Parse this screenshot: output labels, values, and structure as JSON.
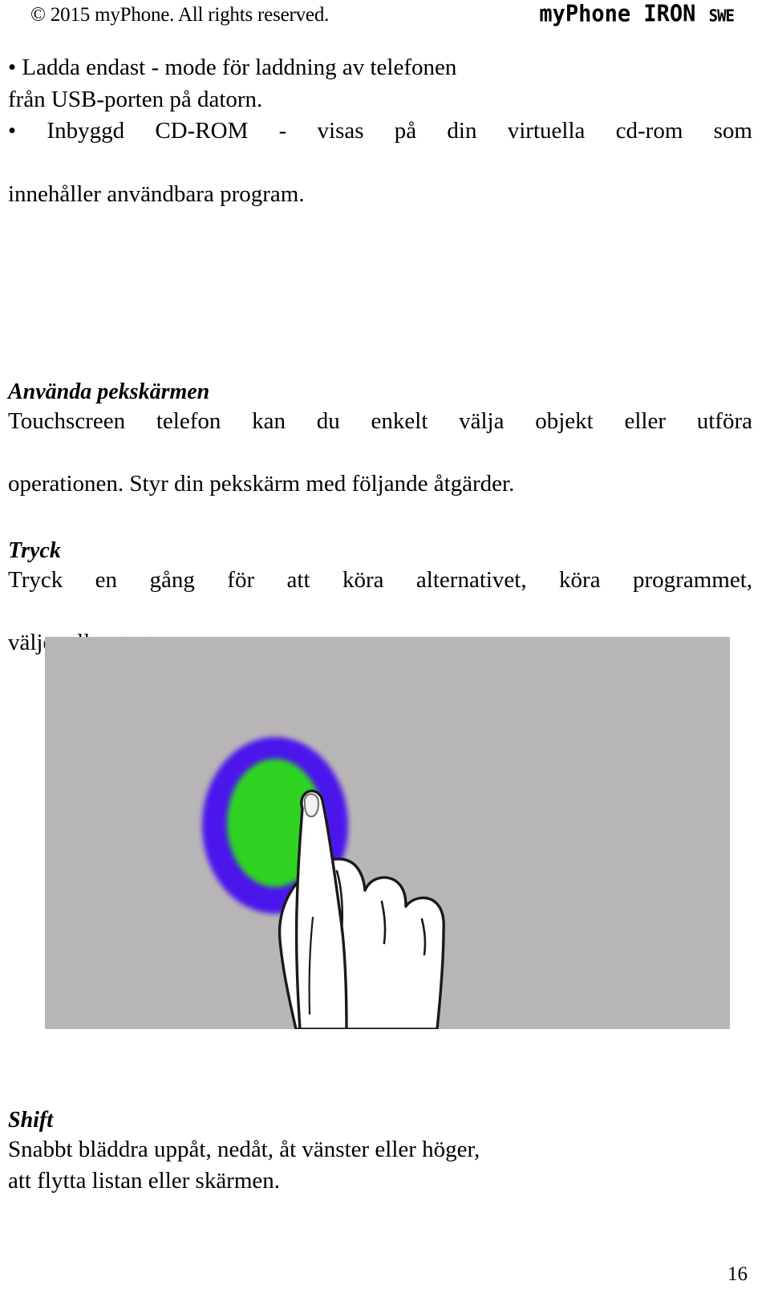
{
  "header": {
    "copyright": "© 2015 myPhone. All rights reserved.",
    "brand": "myPhone IRON",
    "brand_suffix": "SWE"
  },
  "bullets": [
    {
      "marker": "•",
      "line1": "Ladda endast - mode för laddning av telefonen",
      "line2": "från USB-porten på datorn."
    },
    {
      "marker": "•",
      "line1": "Inbyggd CD-ROM - visas på din virtuella cd-rom som",
      "line2": "innehåller användbara program."
    }
  ],
  "sections": {
    "touchscreen": {
      "heading": "Använda pekskärmen",
      "line1": "Touchscreen telefon kan du enkelt välja objekt eller utföra",
      "line2": "operationen. Styr din pekskärm med följande åtgärder."
    },
    "tryck": {
      "heading": "Tryck",
      "line1": "Tryck en gång för att köra alternativet, köra programmet,",
      "line2": "väljer eller startmenyn."
    },
    "shift": {
      "heading": "Shift",
      "line1": "Snabbt bläddra uppåt, nedåt, åt vänster eller höger,",
      "line2": "att flytta listan eller skärmen."
    }
  },
  "figure": {
    "name": "tap-gesture-illustration",
    "background_color": "#b8b5b7",
    "outer_ring_color": "#4b18ec",
    "inner_circle_color": "#2ed322",
    "hand_fill_color": "#ffffff",
    "hand_outline_color": "#1a1a1a"
  },
  "footer": {
    "page_number": "16"
  }
}
